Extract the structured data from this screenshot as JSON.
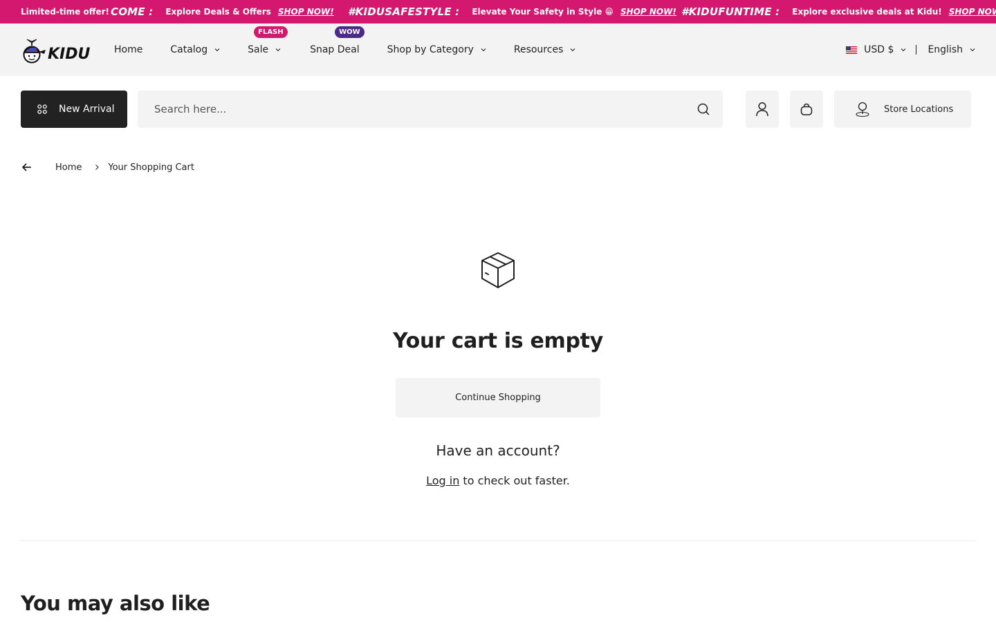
{
  "announcement": {
    "lead": "Limited-time offer!",
    "segments": [
      {
        "tag": "COME :",
        "message": "Explore Deals & Offers",
        "cta": "SHOP NOW!"
      },
      {
        "tag": "#KIDUSAFESTYLE :",
        "message": "Elevate Your Safety in Style 😁",
        "cta": "SHOP NOW!"
      },
      {
        "tag": "#KIDUFUNTIME :",
        "message": "Explore exclusive deals at Kidu!",
        "cta": "SHOP NOW!"
      }
    ],
    "background_color": "#d4176f"
  },
  "header": {
    "logo_text": "KIDU",
    "nav": [
      {
        "label": "Home"
      },
      {
        "label": "Catalog"
      },
      {
        "label": "Sale",
        "badge": "FLASH"
      },
      {
        "label": "Snap Deal",
        "badge": "WOW"
      },
      {
        "label": "Shop by Category"
      },
      {
        "label": "Resources"
      }
    ],
    "currency": "USD $",
    "language": "English"
  },
  "toolbar": {
    "new_arrival_label": "New Arrival",
    "search_placeholder": "Search here...",
    "store_locations_label": "Store Locations"
  },
  "breadcrumb": {
    "home": "Home",
    "current": "Your Shopping Cart"
  },
  "cart": {
    "empty_title": "Your cart is empty",
    "continue_label": "Continue Shopping",
    "account_question": "Have an account?",
    "login_link": "Log in",
    "login_suffix": " to check out faster."
  },
  "recommendations": {
    "title": "You may also like"
  },
  "colors": {
    "accent": "#d4176f",
    "badge_wow": "#4b2a8a",
    "dark_button": "#222222",
    "surface": "#f3f3f3"
  },
  "icons": [
    "kidu-logo",
    "chevron-down-icon",
    "us-flag-icon",
    "grid-icon",
    "search-icon",
    "user-icon",
    "bag-icon",
    "location-pin-icon",
    "arrow-left-icon",
    "chevron-right-icon",
    "box-icon"
  ]
}
